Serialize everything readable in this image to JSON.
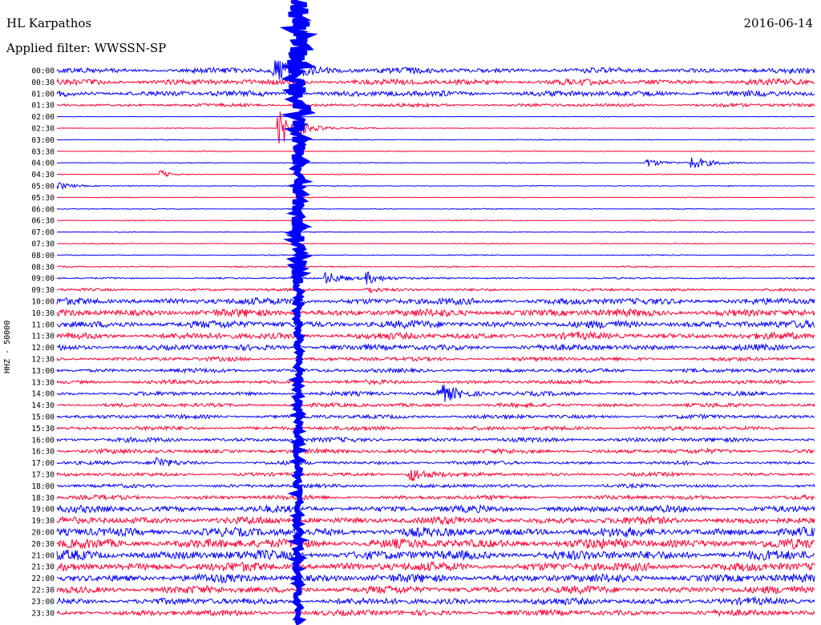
{
  "header": {
    "station": "HL Karpathos",
    "date": "2016-06-14",
    "filter": "Applied filter: WWSSN-SP"
  },
  "chart_data": {
    "type": "line",
    "ylabel": "HHZ - 50000",
    "row_labels": [
      "00:00",
      "00:30",
      "01:00",
      "01:30",
      "02:00",
      "02:30",
      "03:00",
      "03:30",
      "04:00",
      "04:30",
      "05:00",
      "05:30",
      "06:00",
      "06:30",
      "07:00",
      "07:30",
      "08:00",
      "08:30",
      "09:00",
      "09:30",
      "10:00",
      "10:30",
      "11:00",
      "11:30",
      "12:00",
      "12:30",
      "13:00",
      "13:30",
      "14:00",
      "14:30",
      "15:00",
      "15:30",
      "16:00",
      "16:30",
      "17:00",
      "17:30",
      "18:00",
      "18:30",
      "19:00",
      "19:30",
      "20:00",
      "20:30",
      "21:00",
      "21:30",
      "22:00",
      "22:30",
      "23:00",
      "23:30"
    ],
    "trace_colors": [
      "#0000ff",
      "#ff0033"
    ],
    "noise_levels": [
      0.75,
      0.8,
      0.8,
      0.45,
      0.08,
      0.1,
      0.12,
      0.12,
      0.12,
      0.12,
      0.12,
      0.1,
      0.12,
      0.12,
      0.12,
      0.12,
      0.14,
      0.18,
      0.22,
      0.35,
      0.9,
      1.0,
      1.0,
      0.9,
      0.8,
      0.55,
      0.55,
      0.55,
      0.55,
      0.55,
      0.55,
      0.55,
      0.6,
      0.6,
      0.5,
      0.5,
      0.5,
      0.6,
      0.9,
      1.0,
      1.2,
      1.3,
      1.3,
      1.2,
      1.1,
      1.0,
      0.9,
      0.8
    ],
    "events": [
      {
        "row": 0,
        "start": 0.284,
        "dur": 0.06,
        "amp": 3.0
      },
      {
        "row": 5,
        "start": 0.29,
        "dur": 0.04,
        "amp": 6.0
      },
      {
        "row": 8,
        "start": 0.776,
        "dur": 0.03,
        "amp": 1.6
      },
      {
        "row": 8,
        "start": 0.832,
        "dur": 0.04,
        "amp": 2.2
      },
      {
        "row": 9,
        "start": 0.135,
        "dur": 0.015,
        "amp": 1.5
      },
      {
        "row": 10,
        "start": 0.0,
        "dur": 0.03,
        "amp": 1.3
      },
      {
        "row": 18,
        "start": 0.352,
        "dur": 0.04,
        "amp": 2.0
      },
      {
        "row": 18,
        "start": 0.405,
        "dur": 0.03,
        "amp": 2.2
      },
      {
        "row": 19,
        "start": 0.405,
        "dur": 0.02,
        "amp": 1.5
      },
      {
        "row": 28,
        "start": 0.5,
        "dur": 0.04,
        "amp": 3.5
      },
      {
        "row": 34,
        "start": 0.127,
        "dur": 0.025,
        "amp": 2.2
      },
      {
        "row": 35,
        "start": 0.462,
        "dur": 0.03,
        "amp": 3.0
      }
    ]
  }
}
